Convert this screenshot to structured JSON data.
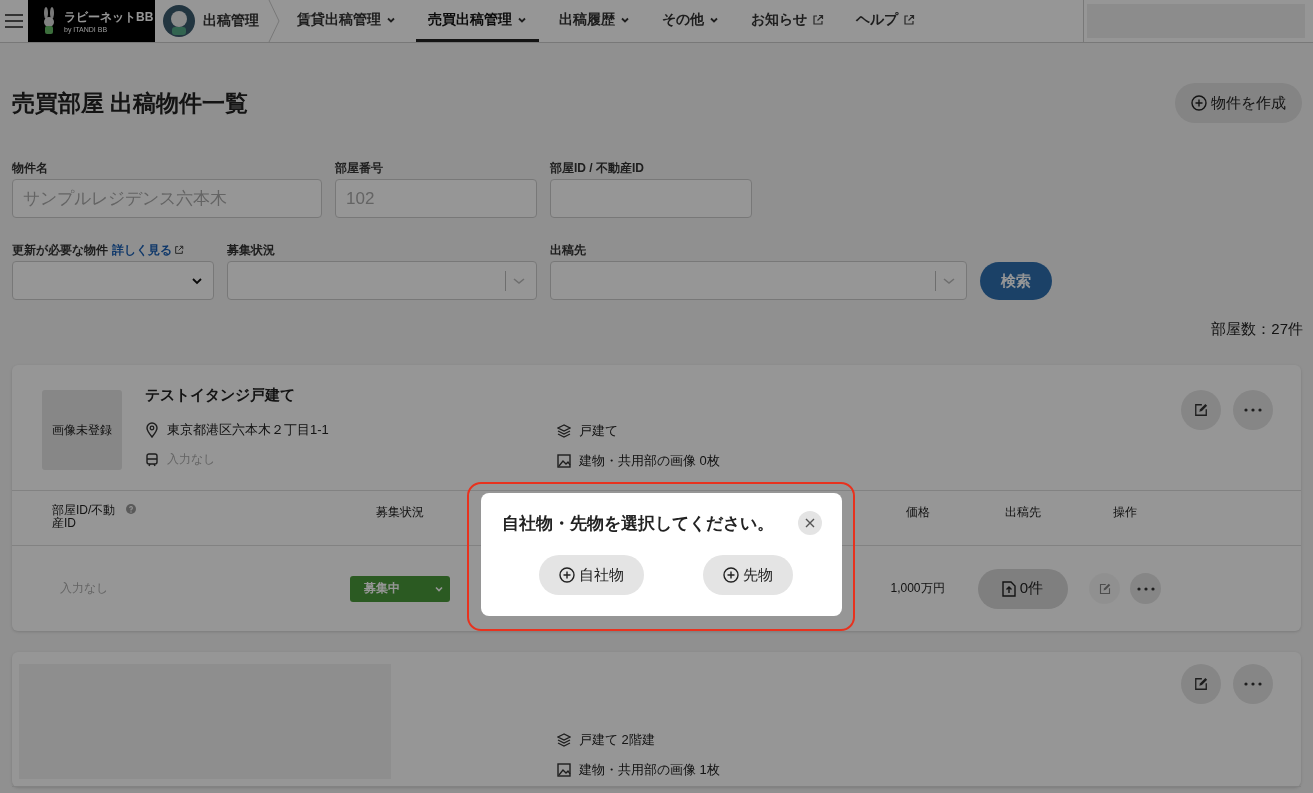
{
  "nav": {
    "logo": {
      "name": "ラビーネットBB",
      "tagline": "by ITANDI BB"
    },
    "breadcrumb": "出稿管理",
    "tabs": [
      {
        "label": "賃貸出稿管理",
        "kind": "dropdown",
        "selected": false
      },
      {
        "label": "売買出稿管理",
        "kind": "dropdown",
        "selected": true
      },
      {
        "label": "出稿履歴",
        "kind": "dropdown",
        "selected": false
      },
      {
        "label": "その他",
        "kind": "dropdown",
        "selected": false
      },
      {
        "label": "お知らせ",
        "kind": "external",
        "selected": false
      },
      {
        "label": "ヘルプ",
        "kind": "external",
        "selected": false
      }
    ]
  },
  "page": {
    "title": "売買部屋 出稿物件一覧",
    "create_button": "物件を作成"
  },
  "search_form": {
    "text_fields": [
      {
        "label": "物件名",
        "placeholder": "サンプルレジデンス六本木"
      },
      {
        "label": "部屋番号",
        "placeholder": "102"
      },
      {
        "label": "部屋ID / 不動産ID"
      }
    ],
    "select_fields": [
      {
        "label": "更新が必要な物件",
        "link": "詳しく見る",
        "kind": "native"
      },
      {
        "label": "募集状況",
        "kind": "combo"
      },
      {
        "label": "出稿先",
        "kind": "combo"
      }
    ],
    "search_button": "検索"
  },
  "room_count": "部屋数：27件",
  "properties": [
    {
      "kind": "placeholder",
      "image_text": "画像未登録",
      "title": "テストイタンジ戸建て",
      "address": "東京都港区六本木２丁目1-1",
      "station": "入力なし",
      "type": "戸建て",
      "images": "建物・共用部の画像 0枚",
      "columns": [
        "部屋ID/不動産ID",
        "募集状況",
        "価格",
        "出稿先",
        "操作"
      ],
      "rooms": [
        {
          "id": "入力なし",
          "status": "募集中",
          "price": "1,000万円",
          "listings": "0件",
          "edit_disabled": true
        }
      ]
    },
    {
      "kind": "loading",
      "type": "戸建て 2階建",
      "images": "建物・共用部の画像 1枚"
    }
  ],
  "modal": {
    "title": "自社物・先物を選択してください。",
    "buttons": [
      "自社物",
      "先物"
    ],
    "highlighted": true
  }
}
